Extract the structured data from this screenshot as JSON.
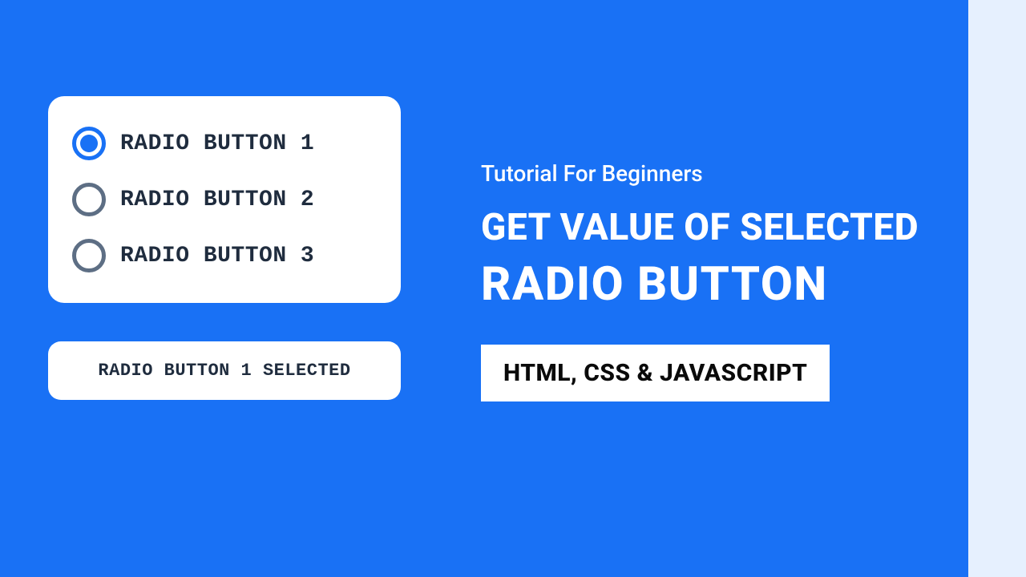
{
  "radio": {
    "options": [
      {
        "label": "RADIO BUTTON 1",
        "selected": true
      },
      {
        "label": "RADIO BUTTON 2",
        "selected": false
      },
      {
        "label": "RADIO BUTTON 3",
        "selected": false
      }
    ],
    "status": "RADIO BUTTON 1 SELECTED"
  },
  "hero": {
    "subtitle": "Tutorial For Beginners",
    "heading_line1": "GET VALUE OF SELECTED",
    "heading_line2": "RADIO BUTTON",
    "tech_badge": "HTML, CSS & JAVASCRIPT"
  }
}
